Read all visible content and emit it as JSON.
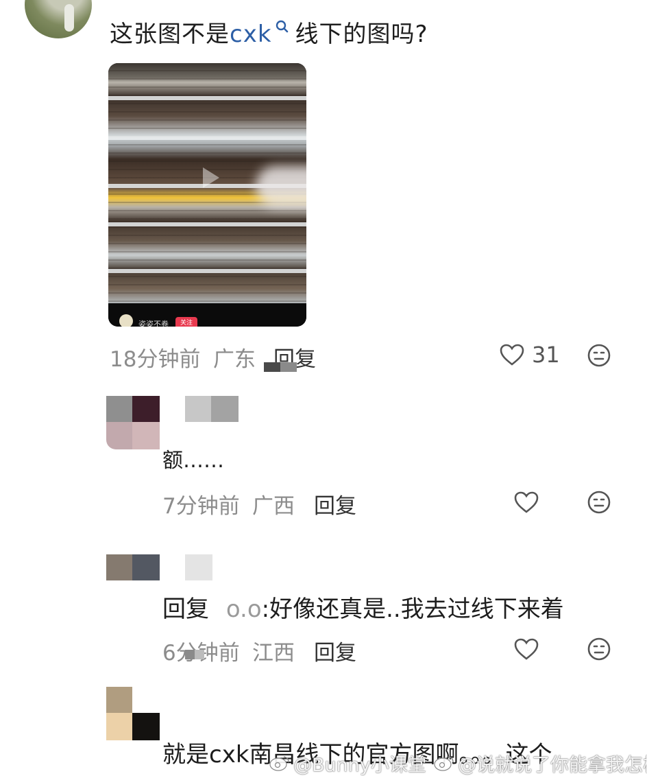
{
  "comment1": {
    "text_before": "这张图不是",
    "keyword": "cxk",
    "text_after": "线下的图吗?",
    "video": {
      "author": "姿姿不卷",
      "follow_label": "关注"
    },
    "time": "18分钟前",
    "location": "广东",
    "reply_label": "回复",
    "likes": "31"
  },
  "reply1": {
    "text": "额……",
    "time": "7分钟前",
    "location": "广西",
    "reply_label": "回复"
  },
  "reply2": {
    "prefix": "回复",
    "reply_to": "o.o",
    "text": ":好像还真是..我去过线下来着",
    "time": "6分钟前",
    "location": "江西",
    "reply_label": "回复"
  },
  "reply3": {
    "text": "就是cxk南昌线下的官方图啊。。。这个"
  },
  "watermarks": {
    "left": "@Bunny小课堂",
    "right": "@说就说了你能拿我怎样"
  },
  "colors": {
    "keyword": "#2d5fa6",
    "meta": "#8c8c8c",
    "follow": "#e83a4f"
  }
}
